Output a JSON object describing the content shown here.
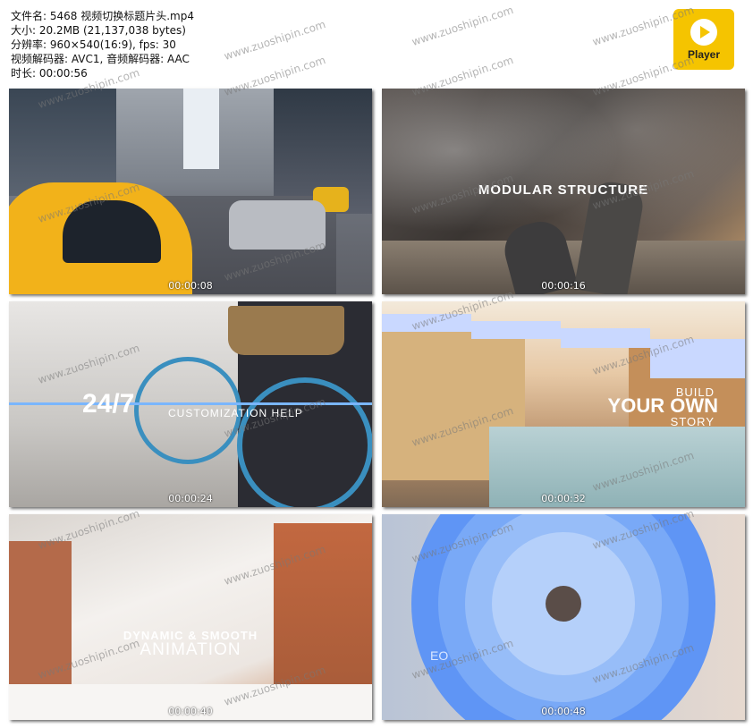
{
  "info": {
    "filename": "文件名: 5468 视频切换标题片头.mp4",
    "size": "大小: 20.2MB (21,137,038 bytes)",
    "resolution": "分辨率: 960×540(16:9), fps: 30",
    "codec": "视频解码器: AVC1, 音频解码器: AAC",
    "duration": "时长: 00:00:56"
  },
  "logo": {
    "label": "Player",
    "color": "#f5c400"
  },
  "watermark": "www.zuoshipin.com",
  "thumbnails": [
    {
      "timestamp": "00:00:08"
    },
    {
      "timestamp": "00:00:16",
      "title": "MODULAR STRUCTURE"
    },
    {
      "timestamp": "00:00:24",
      "big": "24/7",
      "sub": "CUSTOMIZATION HELP"
    },
    {
      "timestamp": "00:00:32",
      "line1": "BUILD",
      "line2": "YOUR OWN",
      "line3": "STORY"
    },
    {
      "timestamp": "00:00:40",
      "line1": "DYNAMIC & SMOOTH",
      "line2": "ANIMATION"
    },
    {
      "timestamp": "00:00:48",
      "text": "EO"
    }
  ]
}
